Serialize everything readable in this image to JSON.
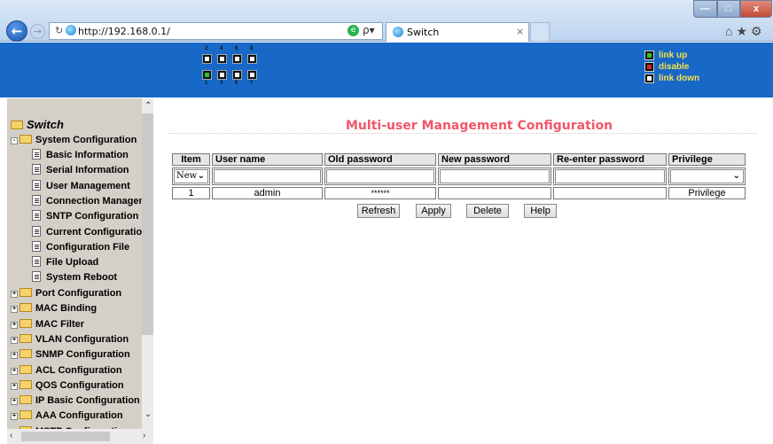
{
  "browser": {
    "url": "http://192.168.0.1/",
    "tab_title": "Switch",
    "tab_close": "×",
    "window_buttons": {
      "minimize": "—",
      "maximize": "□",
      "close": "x"
    },
    "right_icons": "⌂★⚙",
    "back_glyph": "←",
    "forward_glyph": "→",
    "refresh_glyph": "↻",
    "search_glyph": "ρ▾"
  },
  "banner": {
    "top_port_numbers": [
      "2",
      "4",
      "6",
      "8"
    ],
    "bottom_port_numbers": [
      "1",
      "3",
      "5",
      "7"
    ],
    "port_states": {
      "1": "up",
      "2": "down",
      "3": "down",
      "4": "down",
      "5": "down",
      "6": "down",
      "7": "down",
      "8": "down"
    },
    "legend": [
      {
        "label": "link up",
        "color": "#2ec433"
      },
      {
        "label": "disable",
        "color": "#e02020"
      },
      {
        "label": "link down",
        "color": "#ffffff"
      }
    ]
  },
  "sidebar": {
    "root": "Switch",
    "open_folder": "System Configuration",
    "children": [
      "Basic Information",
      "Serial Information",
      "User Management",
      "Connection Managem",
      "SNTP Configuration",
      "Current Configuration",
      "Configuration File",
      "File Upload",
      "System Reboot"
    ],
    "folders": [
      "Port Configuration",
      "MAC Binding",
      "MAC Filter",
      "VLAN Configuration",
      "SNMP Configuration",
      "ACL Configuration",
      "QOS Configuration",
      "IP Basic Configuration",
      "AAA Configuration",
      "MSTP Configuration"
    ]
  },
  "main": {
    "title": "Multi-user Management Configuration",
    "columns": [
      "Item",
      "User name",
      "Old password",
      "New password",
      "Re-enter password",
      "Privilege"
    ],
    "new_row": {
      "item_select": "New",
      "privilege_select": ""
    },
    "rows": [
      {
        "item": "1",
        "user_name": "admin",
        "old_password": "******",
        "new_password": "",
        "reenter_password": "",
        "privilege": "Privilege"
      }
    ],
    "buttons": {
      "refresh": "Refresh",
      "apply": "Apply",
      "delete": "Delete",
      "help": "Help"
    }
  }
}
